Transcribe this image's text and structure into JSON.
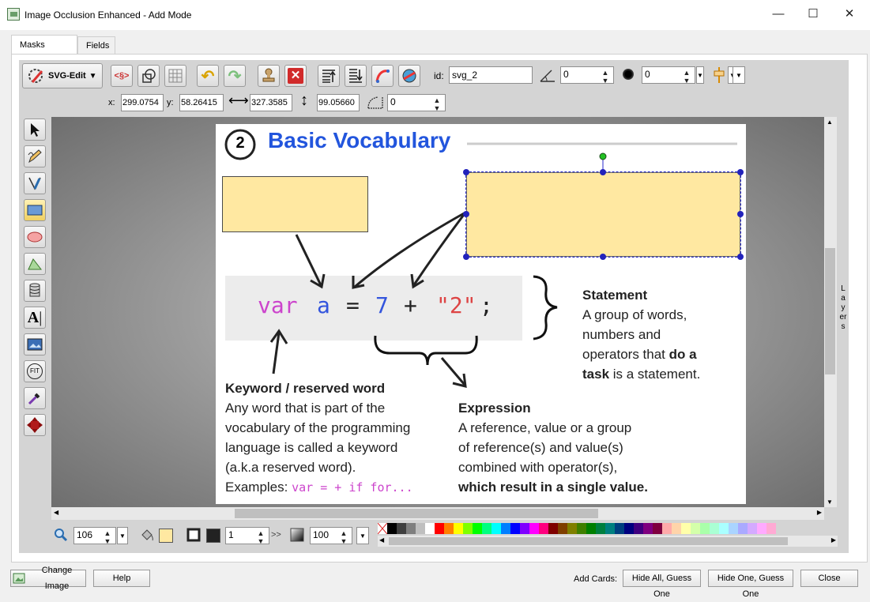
{
  "window": {
    "title": "Image Occlusion Enhanced - Add Mode",
    "minimize": "—",
    "maximize": "☐",
    "close": "✕"
  },
  "tabs": [
    {
      "label": "Masks Editor",
      "active": true
    },
    {
      "label": "Fields",
      "active": false
    }
  ],
  "toolbar": {
    "svgedit_label": "SVG-Edit",
    "id_label": "id:",
    "id_value": "svg_2",
    "angle_value": "0",
    "blur_value": "0",
    "x_label": "x:",
    "x_value": "299.0754",
    "y_label": "y:",
    "y_value": "58.26415",
    "width_value": "327.3585",
    "height_value": "99.05660",
    "radius_value": "0"
  },
  "left_tools": [
    "select-tool",
    "pencil-tool",
    "path-tool",
    "rect-tool",
    "ellipse-tool",
    "polygon-tool",
    "database-tool",
    "text-tool",
    "image-tool",
    "fit-tool",
    "eyedropper-tool",
    "move-tool"
  ],
  "slide": {
    "number": "2",
    "title": "Basic Vocabulary",
    "code": {
      "keyword": "var",
      "ident": "a",
      "eq": "=",
      "num": "7",
      "plus": "+",
      "str": "\"2\"",
      "semi": ";"
    },
    "statement": {
      "heading": "Statement",
      "line1": "A group of words,",
      "line2": "numbers and",
      "line3a": "operators that ",
      "line3b": "do a",
      "line4a": "task",
      "line4b": " is a statement."
    },
    "keyword_block": {
      "heading": "Keyword / reserved word",
      "line1": "Any word that is part of the",
      "line2": "vocabulary of the programming",
      "line3": "language is called a keyword",
      "line4": "(a.k.a reserved word).",
      "examples_label": "Examples: ",
      "examples": "var = + if for..."
    },
    "expression": {
      "heading": "Expression",
      "line1": "A reference, value or a group",
      "line2": "of reference(s) and value(s)",
      "line3": "combined with operator(s),",
      "line4": "which result in a single value."
    }
  },
  "layers_label": "Layers",
  "bottom": {
    "zoom_value": "106",
    "stroke_width": "1",
    "opacity": "100",
    "more": ">>"
  },
  "palette": [
    "#000000",
    "#3f3f3f",
    "#7f7f7f",
    "#bfbfbf",
    "#ffffff",
    "#ff0000",
    "#ff7f00",
    "#ffff00",
    "#7fff00",
    "#00ff00",
    "#00ff7f",
    "#00ffff",
    "#007fff",
    "#0000ff",
    "#7f00ff",
    "#ff00ff",
    "#ff007f",
    "#7f0000",
    "#7f3f00",
    "#7f7f00",
    "#3f7f00",
    "#007f00",
    "#007f3f",
    "#007f7f",
    "#003f7f",
    "#00007f",
    "#3f007f",
    "#7f007f",
    "#7f003f",
    "#ffaaaa",
    "#ffd4aa",
    "#ffffaa",
    "#d4ffaa",
    "#aaffaa",
    "#aaffd4",
    "#aaffff",
    "#aad4ff",
    "#aaaaff",
    "#d4aaff",
    "#ffaaff",
    "#ffaad4"
  ],
  "colors": {
    "mask_fill": "#ffe8a1",
    "mask_stroke": "#4a4a4a",
    "selection": "#2a2acc",
    "title_blue": "#2255dd",
    "keyword_purple": "#cc44cc",
    "number_blue": "#3355dd",
    "string_red": "#dd4444"
  },
  "footer": {
    "change_image": "Change Image",
    "help": "Help",
    "add_cards_label": "Add Cards:",
    "hide_all": "Hide All, Guess One",
    "hide_one": "Hide One, Guess One",
    "close": "Close"
  }
}
